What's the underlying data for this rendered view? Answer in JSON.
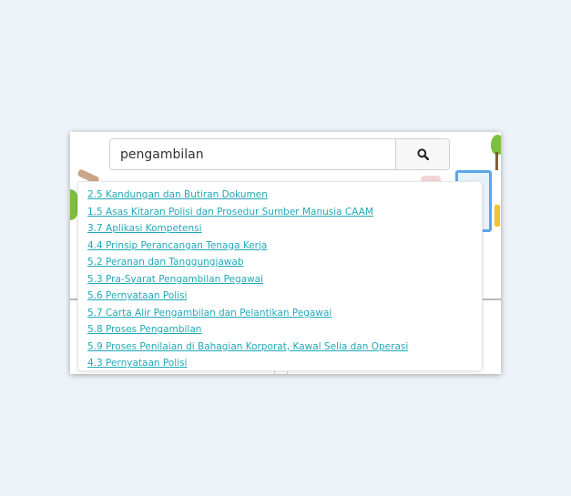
{
  "search": {
    "value": "pengambilan"
  },
  "results": [
    "2.5 Kandungan dan Butiran Dokumen",
    "1.5 Asas Kitaran Polisi dan Prosedur Sumber Manusia CAAM",
    "3.7 Aplikasi Kompetensi",
    "4.4 Prinsip Perancangan Tenaga Kerja",
    "5.2 Peranan dan Tanggungjawab",
    "5.3 Pra-Syarat Pengambilan Pegawai",
    "5.6 Pernyataan Polisi",
    "5.7 Carta Alir Pengambilan dan Pelantikan Pegawai",
    "5.8 Proses Pengambilan",
    "5.9 Proses Penilaian di Bahagian Korporat, Kawal Selia dan Operasi",
    "4.3 Pernyataan Polisi"
  ],
  "colors": {
    "page_bg": "#eef3f9",
    "link": "#22a8b8"
  }
}
